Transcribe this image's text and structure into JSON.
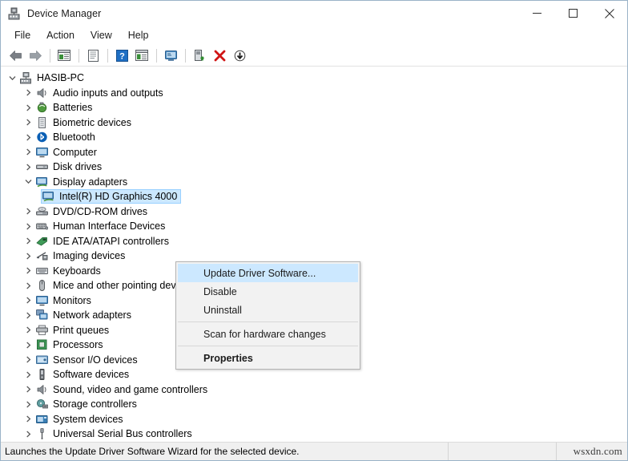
{
  "window": {
    "title": "Device Manager",
    "icon": "device-manager-icon",
    "controls": {
      "minimize": "minimize-icon",
      "maximize": "maximize-icon",
      "close": "close-icon"
    }
  },
  "menubar": {
    "items": [
      {
        "label": "File"
      },
      {
        "label": "Action"
      },
      {
        "label": "View"
      },
      {
        "label": "Help"
      }
    ]
  },
  "toolbar": {
    "buttons": [
      {
        "name": "back-icon",
        "tip": "Back"
      },
      {
        "name": "forward-icon",
        "tip": "Forward"
      },
      {
        "name": "separator-1"
      },
      {
        "name": "show-hide-console-tree-icon",
        "tip": "Show/Hide Console Tree"
      },
      {
        "name": "separator-2"
      },
      {
        "name": "properties-icon",
        "tip": "Properties"
      },
      {
        "name": "separator-3"
      },
      {
        "name": "help-icon",
        "tip": "Help"
      },
      {
        "name": "separator-4"
      },
      {
        "name": "view-devices-icon",
        "tip": "View"
      },
      {
        "name": "separator-5"
      },
      {
        "name": "scan-for-hardware-changes-icon",
        "tip": "Scan for hardware changes"
      },
      {
        "name": "separator-6"
      },
      {
        "name": "update-driver-software-icon",
        "tip": "Update Driver Software"
      },
      {
        "name": "uninstall-icon",
        "tip": "Uninstall"
      },
      {
        "name": "disable-icon",
        "tip": "Disable"
      }
    ]
  },
  "tree": {
    "root": {
      "label": "HASIB-PC",
      "icon": "computer-icon",
      "expanded": true
    },
    "nodes": [
      {
        "label": "Audio inputs and outputs",
        "icon": "speaker-icon",
        "depth": 1,
        "expanded": false
      },
      {
        "label": "Batteries",
        "icon": "battery-icon",
        "depth": 1,
        "expanded": false
      },
      {
        "label": "Biometric devices",
        "icon": "biometric-icon",
        "depth": 1,
        "expanded": false
      },
      {
        "label": "Bluetooth",
        "icon": "bluetooth-icon",
        "depth": 1,
        "expanded": false
      },
      {
        "label": "Computer",
        "icon": "monitor-icon",
        "depth": 1,
        "expanded": false
      },
      {
        "label": "Disk drives",
        "icon": "disk-drive-icon",
        "depth": 1,
        "expanded": false
      },
      {
        "label": "Display adapters",
        "icon": "display-adapter-icon",
        "depth": 1,
        "expanded": true
      },
      {
        "label": "Intel(R) HD Graphics 4000",
        "icon": "display-adapter-icon",
        "depth": 2,
        "selected": true
      },
      {
        "label": "DVD/CD-ROM drives",
        "icon": "dvd-drive-icon",
        "depth": 1,
        "expanded": false
      },
      {
        "label": "Human Interface Devices",
        "icon": "hid-icon",
        "depth": 1,
        "expanded": false
      },
      {
        "label": "IDE ATA/ATAPI controllers",
        "icon": "ide-controller-icon",
        "depth": 1,
        "expanded": false
      },
      {
        "label": "Imaging devices",
        "icon": "imaging-device-icon",
        "depth": 1,
        "expanded": false
      },
      {
        "label": "Keyboards",
        "icon": "keyboard-icon",
        "depth": 1,
        "expanded": false
      },
      {
        "label": "Mice and other pointing devices",
        "icon": "mouse-icon",
        "depth": 1,
        "expanded": false
      },
      {
        "label": "Monitors",
        "icon": "monitor-icon",
        "depth": 1,
        "expanded": false
      },
      {
        "label": "Network adapters",
        "icon": "network-adapter-icon",
        "depth": 1,
        "expanded": false
      },
      {
        "label": "Print queues",
        "icon": "printer-icon",
        "depth": 1,
        "expanded": false
      },
      {
        "label": "Processors",
        "icon": "processor-icon",
        "depth": 1,
        "expanded": false
      },
      {
        "label": "Sensor I/O devices",
        "icon": "sensor-icon",
        "depth": 1,
        "expanded": false
      },
      {
        "label": "Software devices",
        "icon": "software-device-icon",
        "depth": 1,
        "expanded": false
      },
      {
        "label": "Sound, video and game controllers",
        "icon": "speaker-icon",
        "depth": 1,
        "expanded": false
      },
      {
        "label": "Storage controllers",
        "icon": "storage-controller-icon",
        "depth": 1,
        "expanded": false
      },
      {
        "label": "System devices",
        "icon": "system-device-icon",
        "depth": 1,
        "expanded": false
      },
      {
        "label": "Universal Serial Bus controllers",
        "icon": "usb-icon",
        "depth": 1,
        "expanded": false
      }
    ]
  },
  "context_menu": {
    "items": [
      {
        "label": "Update Driver Software...",
        "highlighted": true,
        "bold": false
      },
      {
        "label": "Disable",
        "highlighted": false,
        "bold": false
      },
      {
        "label": "Uninstall",
        "highlighted": false,
        "bold": false
      },
      {
        "separator": true
      },
      {
        "label": "Scan for hardware changes",
        "highlighted": false,
        "bold": false
      },
      {
        "separator": true
      },
      {
        "label": "Properties",
        "highlighted": false,
        "bold": true
      }
    ]
  },
  "statusbar": {
    "text": "Launches the Update Driver Software Wizard for the selected device.",
    "watermark": "wsxdn.com"
  },
  "colors": {
    "selection_fill": "#cce8ff",
    "selection_border": "#99d1ff",
    "window_border": "#9ab3c8",
    "menu_bg": "#f2f2f2",
    "statusbar_bg": "#f0f0f0"
  }
}
